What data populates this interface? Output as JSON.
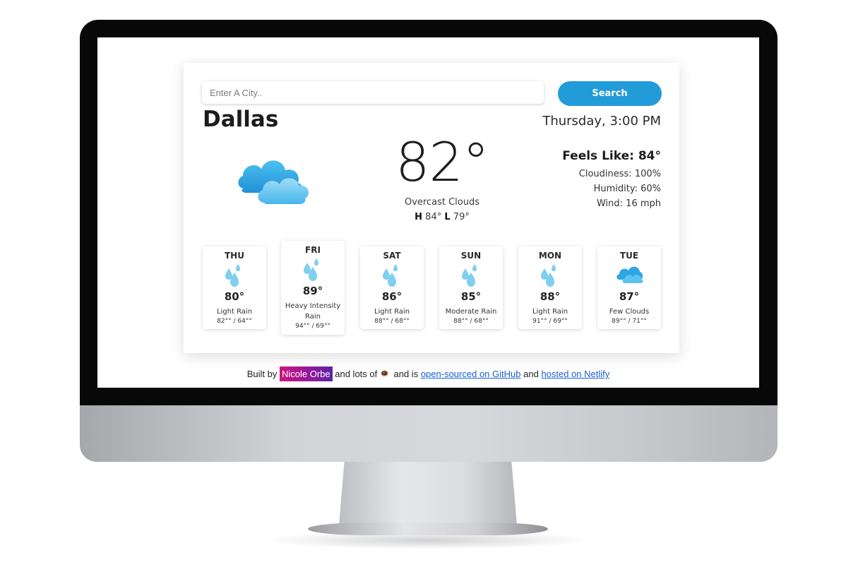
{
  "search": {
    "placeholder": "Enter A City..",
    "value": "",
    "button_label": "Search"
  },
  "current": {
    "city": "Dallas",
    "datetime": "Thursday, 3:00 PM",
    "temperature": "82°",
    "description": "Overcast Clouds",
    "high_label": "H",
    "high": "84°",
    "low_label": "L",
    "low": "79°",
    "icon": "overcast-clouds-icon",
    "feels_like": "Feels Like: 84°",
    "cloudiness": "Cloudiness: 100%",
    "humidity": "Humidity: 60%",
    "wind": "Wind: 16 mph"
  },
  "forecast": [
    {
      "day": "THU",
      "temp": "80°",
      "desc": "Light Rain",
      "range": "82°° / 64°°",
      "icon": "rain-drops-icon"
    },
    {
      "day": "FRI",
      "temp": "89°",
      "desc": "Heavy Intensity Rain",
      "range": "94°° / 69°°",
      "icon": "rain-drops-icon"
    },
    {
      "day": "SAT",
      "temp": "86°",
      "desc": "Light Rain",
      "range": "88°° / 68°°",
      "icon": "rain-drops-icon"
    },
    {
      "day": "SUN",
      "temp": "85°",
      "desc": "Moderate Rain",
      "range": "88°° / 68°°",
      "icon": "rain-drops-icon"
    },
    {
      "day": "MON",
      "temp": "88°",
      "desc": "Light Rain",
      "range": "91°° / 69°°",
      "icon": "rain-drops-icon"
    },
    {
      "day": "TUE",
      "temp": "87°",
      "desc": "Few Clouds",
      "range": "89°° / 71°°",
      "icon": "cloud-icon"
    }
  ],
  "footer": {
    "built_by": "Built by",
    "author": "Nicole Orbe",
    "and_lots_of": "and lots of",
    "and_is": "and is",
    "github_link": "open-sourced on GitHub",
    "and": "and",
    "netlify_link": "hosted on Netlify"
  },
  "colors": {
    "accent": "#229bd9",
    "cloud": "#3db4ea",
    "drop": "#7fcff0",
    "link": "#1a5fd6"
  }
}
